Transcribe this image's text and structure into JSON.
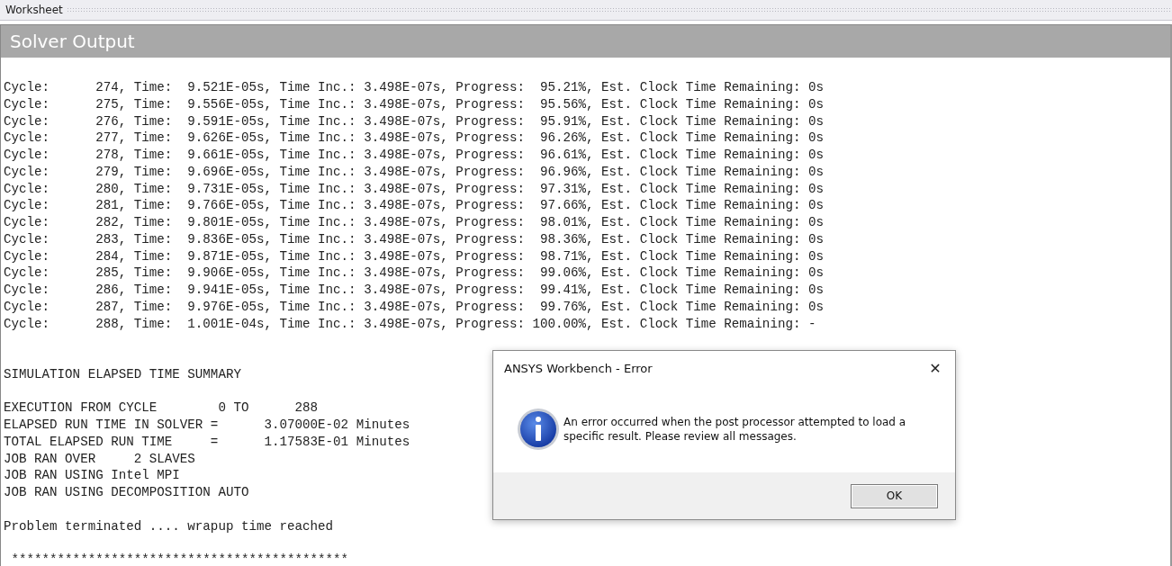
{
  "worksheet_tab": {
    "title": "Worksheet"
  },
  "panel": {
    "title": "Solver Output"
  },
  "cycle_lines": [
    "Cycle:      274, Time:  9.521E-05s, Time Inc.: 3.498E-07s, Progress:  95.21%, Est. Clock Time Remaining: 0s",
    "Cycle:      275, Time:  9.556E-05s, Time Inc.: 3.498E-07s, Progress:  95.56%, Est. Clock Time Remaining: 0s",
    "Cycle:      276, Time:  9.591E-05s, Time Inc.: 3.498E-07s, Progress:  95.91%, Est. Clock Time Remaining: 0s",
    "Cycle:      277, Time:  9.626E-05s, Time Inc.: 3.498E-07s, Progress:  96.26%, Est. Clock Time Remaining: 0s",
    "Cycle:      278, Time:  9.661E-05s, Time Inc.: 3.498E-07s, Progress:  96.61%, Est. Clock Time Remaining: 0s",
    "Cycle:      279, Time:  9.696E-05s, Time Inc.: 3.498E-07s, Progress:  96.96%, Est. Clock Time Remaining: 0s",
    "Cycle:      280, Time:  9.731E-05s, Time Inc.: 3.498E-07s, Progress:  97.31%, Est. Clock Time Remaining: 0s",
    "Cycle:      281, Time:  9.766E-05s, Time Inc.: 3.498E-07s, Progress:  97.66%, Est. Clock Time Remaining: 0s",
    "Cycle:      282, Time:  9.801E-05s, Time Inc.: 3.498E-07s, Progress:  98.01%, Est. Clock Time Remaining: 0s",
    "Cycle:      283, Time:  9.836E-05s, Time Inc.: 3.498E-07s, Progress:  98.36%, Est. Clock Time Remaining: 0s",
    "Cycle:      284, Time:  9.871E-05s, Time Inc.: 3.498E-07s, Progress:  98.71%, Est. Clock Time Remaining: 0s",
    "Cycle:      285, Time:  9.906E-05s, Time Inc.: 3.498E-07s, Progress:  99.06%, Est. Clock Time Remaining: 0s",
    "Cycle:      286, Time:  9.941E-05s, Time Inc.: 3.498E-07s, Progress:  99.41%, Est. Clock Time Remaining: 0s",
    "Cycle:      287, Time:  9.976E-05s, Time Inc.: 3.498E-07s, Progress:  99.76%, Est. Clock Time Remaining: 0s",
    "Cycle:      288, Time:  1.001E-04s, Time Inc.: 3.498E-07s, Progress: 100.00%, Est. Clock Time Remaining: -"
  ],
  "summary": {
    "heading": "SIMULATION ELAPSED TIME SUMMARY",
    "lines": [
      "EXECUTION FROM CYCLE        0 TO      288",
      "ELAPSED RUN TIME IN SOLVER =      3.07000E-02 Minutes",
      "TOTAL ELAPSED RUN TIME     =      1.17583E-01 Minutes",
      "JOB RAN OVER     2 SLAVES",
      "JOB RAN USING Intel MPI",
      "JOB RAN USING DECOMPOSITION AUTO"
    ]
  },
  "termination": "Problem terminated .... wrapup time reached",
  "separator": " ********************************************",
  "dialog": {
    "title": "ANSYS Workbench - Error",
    "close": "✕",
    "message": "An error occurred when the post processor attempted to load a specific result. Please review all messages.",
    "button": "OK"
  }
}
